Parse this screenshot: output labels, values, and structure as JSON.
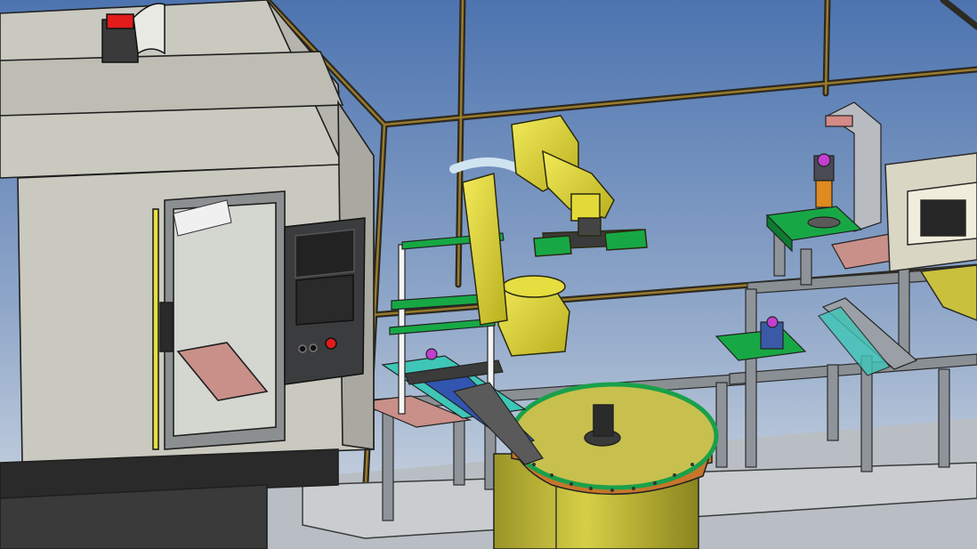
{
  "scene": {
    "kind": "3d-cad-render",
    "subject": "robotic-machine-tending-cell",
    "components": [
      "cnc-machine",
      "machine-control-panel",
      "stack-light",
      "yellow-six-axis-robot",
      "robot-gripper",
      "rotary-feeder-table",
      "aluminium-extrusion-frame",
      "inspection-station",
      "electrical-cabinet",
      "part-conveyor"
    ]
  },
  "colors": {
    "sky_top": "#4d74b0",
    "sky_bottom": "#d4dbe4",
    "floor": "#b8bec3",
    "machine_grey": "#c9c9c0",
    "robot_yellow": "#e8df3c",
    "table_top": "#c8c04e",
    "copper_ring": "#c6752b",
    "green_plate": "#17a845",
    "teal_plate": "#3fc6b8",
    "pink_plate": "#c98f89",
    "frame_bronze": "#8f6d24",
    "button_red": "#e21b1b"
  }
}
